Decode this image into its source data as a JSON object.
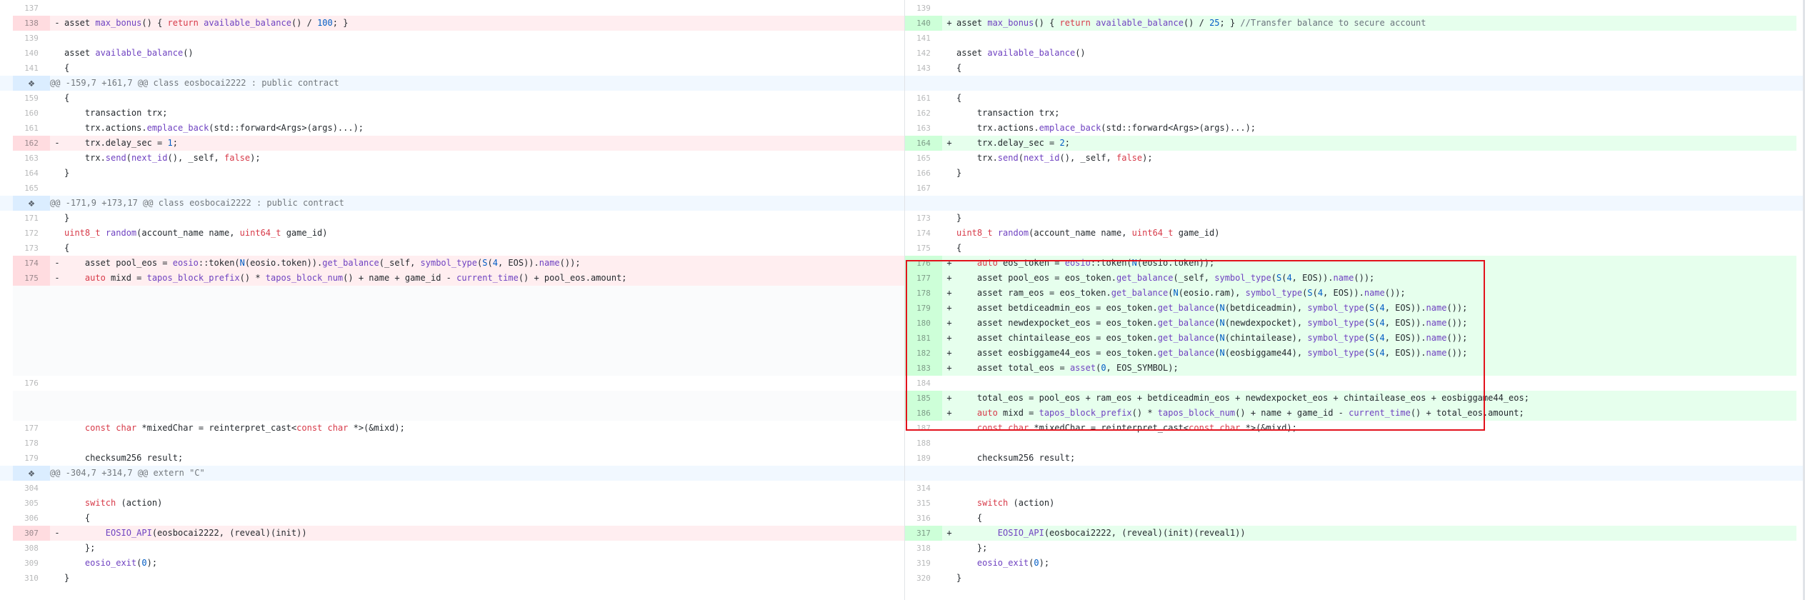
{
  "diff": {
    "accent_colors": {
      "deletion_bg": "#ffeef0",
      "deletion_gutter": "#ffdce0",
      "addition_bg": "#e6ffed",
      "addition_gutter": "#cdffd8",
      "hunk_bg": "#f1f8ff",
      "highlight_box": "#e2121c"
    },
    "expand_icon": "expand-icon",
    "rows": [
      {
        "type": "ctx",
        "left": {
          "num": "137",
          "code": ""
        },
        "right": {
          "num": "139",
          "code": ""
        }
      },
      {
        "type": "chg",
        "left": {
          "num": "138",
          "mark": "-",
          "code": "asset max_bonus() { return available_balance() / 100; }"
        },
        "right": {
          "num": "140",
          "mark": "+",
          "code": "asset max_bonus() { return available_balance() / 25; } //Transfer balance to secure account"
        }
      },
      {
        "type": "ctx",
        "left": {
          "num": "139",
          "code": ""
        },
        "right": {
          "num": "141",
          "code": ""
        }
      },
      {
        "type": "ctx",
        "left": {
          "num": "140",
          "code": "asset available_balance()"
        },
        "right": {
          "num": "142",
          "code": "asset available_balance()"
        }
      },
      {
        "type": "ctx",
        "left": {
          "num": "141",
          "code": "{"
        },
        "right": {
          "num": "143",
          "code": "{"
        }
      },
      {
        "type": "hunk",
        "text": "@@ -159,7 +161,7 @@ class eosbocai2222 : public contract"
      },
      {
        "type": "ctx",
        "left": {
          "num": "159",
          "code": "{"
        },
        "right": {
          "num": "161",
          "code": "{"
        }
      },
      {
        "type": "ctx",
        "left": {
          "num": "160",
          "code": "    transaction trx;"
        },
        "right": {
          "num": "162",
          "code": "    transaction trx;"
        }
      },
      {
        "type": "ctx",
        "left": {
          "num": "161",
          "code": "    trx.actions.emplace_back(std::forward<Args>(args)...);"
        },
        "right": {
          "num": "163",
          "code": "    trx.actions.emplace_back(std::forward<Args>(args)...);"
        }
      },
      {
        "type": "chg",
        "left": {
          "num": "162",
          "mark": "-",
          "code": "    trx.delay_sec = 1;"
        },
        "right": {
          "num": "164",
          "mark": "+",
          "code": "    trx.delay_sec = 2;"
        }
      },
      {
        "type": "ctx",
        "left": {
          "num": "163",
          "code": "    trx.send(next_id(), _self, false);"
        },
        "right": {
          "num": "165",
          "code": "    trx.send(next_id(), _self, false);"
        }
      },
      {
        "type": "ctx",
        "left": {
          "num": "164",
          "code": "}"
        },
        "right": {
          "num": "166",
          "code": "}"
        }
      },
      {
        "type": "ctx",
        "left": {
          "num": "165",
          "code": ""
        },
        "right": {
          "num": "167",
          "code": ""
        }
      },
      {
        "type": "hunk",
        "text": "@@ -171,9 +173,17 @@ class eosbocai2222 : public contract"
      },
      {
        "type": "ctx",
        "left": {
          "num": "171",
          "code": "}"
        },
        "right": {
          "num": "173",
          "code": "}"
        }
      },
      {
        "type": "ctx",
        "left": {
          "num": "172",
          "code": "uint8_t random(account_name name, uint64_t game_id)"
        },
        "right": {
          "num": "174",
          "code": "uint8_t random(account_name name, uint64_t game_id)"
        }
      },
      {
        "type": "ctx",
        "left": {
          "num": "173",
          "code": "{"
        },
        "right": {
          "num": "175",
          "code": "{"
        }
      },
      {
        "type": "chg",
        "left": {
          "num": "174",
          "mark": "-",
          "code": "    asset pool_eos = eosio::token(N(eosio.token)).get_balance(_self, symbol_type(S(4, EOS)).name());"
        },
        "right": {
          "num": "176",
          "mark": "+",
          "code": "    auto eos_token = eosio::token(N(eosio.token));"
        }
      },
      {
        "type": "chg",
        "left": {
          "num": "175",
          "mark": "-",
          "code": "    auto mixd = tapos_block_prefix() * tapos_block_num() + name + game_id - current_time() + pool_eos.amount;"
        },
        "right": {
          "num": "177",
          "mark": "+",
          "code": "    asset pool_eos = eos_token.get_balance(_self, symbol_type(S(4, EOS)).name());"
        }
      },
      {
        "type": "add",
        "right": {
          "num": "178",
          "mark": "+",
          "code": "    asset ram_eos = eos_token.get_balance(N(eosio.ram), symbol_type(S(4, EOS)).name());"
        }
      },
      {
        "type": "add",
        "right": {
          "num": "179",
          "mark": "+",
          "code": "    asset betdiceadmin_eos = eos_token.get_balance(N(betdiceadmin), symbol_type(S(4, EOS)).name());"
        }
      },
      {
        "type": "add",
        "right": {
          "num": "180",
          "mark": "+",
          "code": "    asset newdexpocket_eos = eos_token.get_balance(N(newdexpocket), symbol_type(S(4, EOS)).name());"
        }
      },
      {
        "type": "add",
        "right": {
          "num": "181",
          "mark": "+",
          "code": "    asset chintailease_eos = eos_token.get_balance(N(chintailease), symbol_type(S(4, EOS)).name());"
        }
      },
      {
        "type": "add",
        "right": {
          "num": "182",
          "mark": "+",
          "code": "    asset eosbiggame44_eos = eos_token.get_balance(N(eosbiggame44), symbol_type(S(4, EOS)).name());"
        }
      },
      {
        "type": "add",
        "right": {
          "num": "183",
          "mark": "+",
          "code": "    asset total_eos = asset(0, EOS_SYMBOL);"
        }
      },
      {
        "type": "ctx",
        "left": {
          "num": "176",
          "code": ""
        },
        "right": {
          "num": "184",
          "code": ""
        }
      },
      {
        "type": "add",
        "right": {
          "num": "185",
          "mark": "+",
          "code": "    total_eos = pool_eos + ram_eos + betdiceadmin_eos + newdexpocket_eos + chintailease_eos + eosbiggame44_eos;"
        }
      },
      {
        "type": "add",
        "right": {
          "num": "186",
          "mark": "+",
          "code": "    auto mixd = tapos_block_prefix() * tapos_block_num() + name + game_id - current_time() + total_eos.amount;"
        }
      },
      {
        "type": "ctx",
        "left": {
          "num": "177",
          "code": "    const char *mixedChar = reinterpret_cast<const char *>(&mixd);"
        },
        "right": {
          "num": "187",
          "code": "    const char *mixedChar = reinterpret_cast<const char *>(&mixd);"
        }
      },
      {
        "type": "ctx",
        "left": {
          "num": "178",
          "code": ""
        },
        "right": {
          "num": "188",
          "code": ""
        }
      },
      {
        "type": "ctx",
        "left": {
          "num": "179",
          "code": "    checksum256 result;"
        },
        "right": {
          "num": "189",
          "code": "    checksum256 result;"
        }
      },
      {
        "type": "hunk",
        "text": "@@ -304,7 +314,7 @@ extern \"C\""
      },
      {
        "type": "ctx",
        "left": {
          "num": "304",
          "code": ""
        },
        "right": {
          "num": "314",
          "code": ""
        }
      },
      {
        "type": "ctx",
        "left": {
          "num": "305",
          "code": "    switch (action)"
        },
        "right": {
          "num": "315",
          "code": "    switch (action)"
        }
      },
      {
        "type": "ctx",
        "left": {
          "num": "306",
          "code": "    {"
        },
        "right": {
          "num": "316",
          "code": "    {"
        }
      },
      {
        "type": "chg",
        "left": {
          "num": "307",
          "mark": "-",
          "code": "        EOSIO_API(eosbocai2222, (reveal)(init))"
        },
        "right": {
          "num": "317",
          "mark": "+",
          "code": "        EOSIO_API(eosbocai2222, (reveal)(init)(reveal1))"
        }
      },
      {
        "type": "ctx",
        "left": {
          "num": "308",
          "code": "    };"
        },
        "right": {
          "num": "318",
          "code": "    };"
        }
      },
      {
        "type": "ctx",
        "left": {
          "num": "309",
          "code": "    eosio_exit(0);"
        },
        "right": {
          "num": "319",
          "code": "    eosio_exit(0);"
        }
      },
      {
        "type": "ctx",
        "left": {
          "num": "310",
          "code": "}"
        },
        "right": {
          "num": "320",
          "code": "}"
        }
      }
    ]
  }
}
